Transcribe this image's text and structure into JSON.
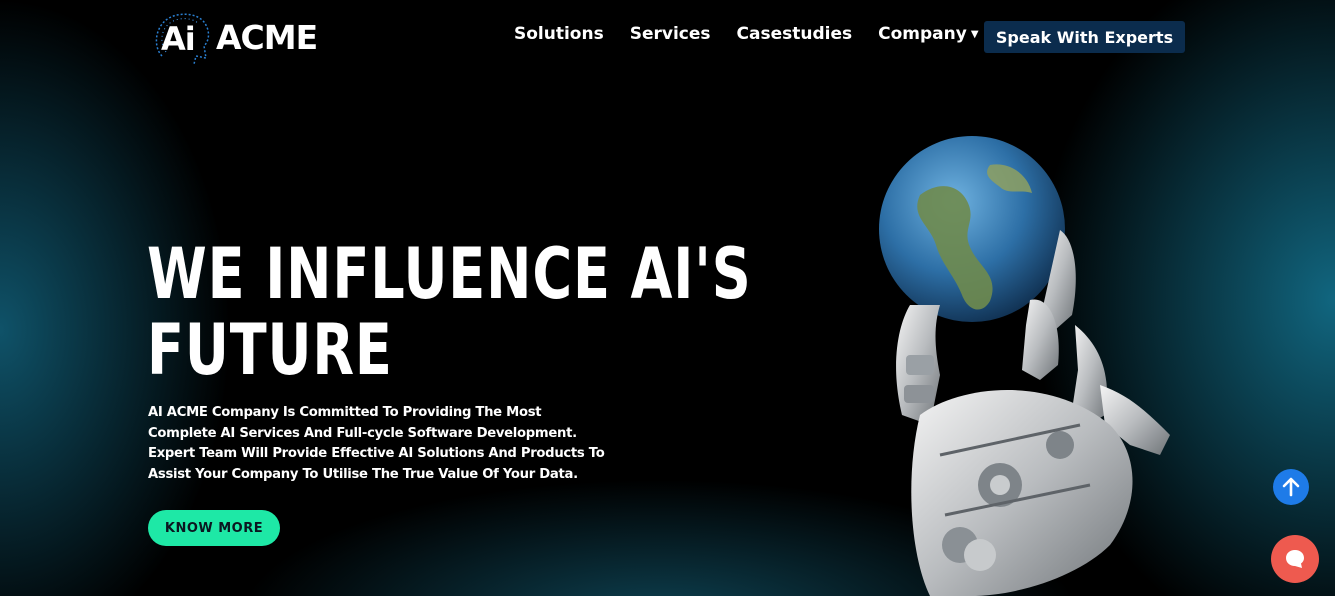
{
  "header": {
    "logo_mark": "Ai",
    "logo_text": "ACME",
    "nav": [
      {
        "label": "Solutions"
      },
      {
        "label": "Services"
      },
      {
        "label": "Casestudies"
      },
      {
        "label": "Company",
        "has_dropdown": true
      }
    ],
    "cta_label": "Speak With Experts"
  },
  "hero": {
    "title_line1": "WE INFLUENCE AI'S",
    "title_line2": "FUTURE",
    "description": "AI ACME Company Is Committed To Providing The Most Complete AI Services And Full-cycle Software Development. Expert Team Will Provide Effective AI Solutions And Products To Assist Your Company To Utilise The True Value Of Your Data.",
    "button_label": "KNOW MORE",
    "image_icon": "robot-hand-holding-globe-icon"
  },
  "floating": {
    "scroll_top_icon": "arrow-up-icon",
    "chat_icon": "chat-bubble-icon"
  },
  "colors": {
    "background": "#000000",
    "glow": "#146e8c",
    "cta_background": "#0b2c4d",
    "know_more_background": "#1ee8a6",
    "scroll_top_background": "#1e7be8",
    "chat_background": "#ee5a4f"
  }
}
